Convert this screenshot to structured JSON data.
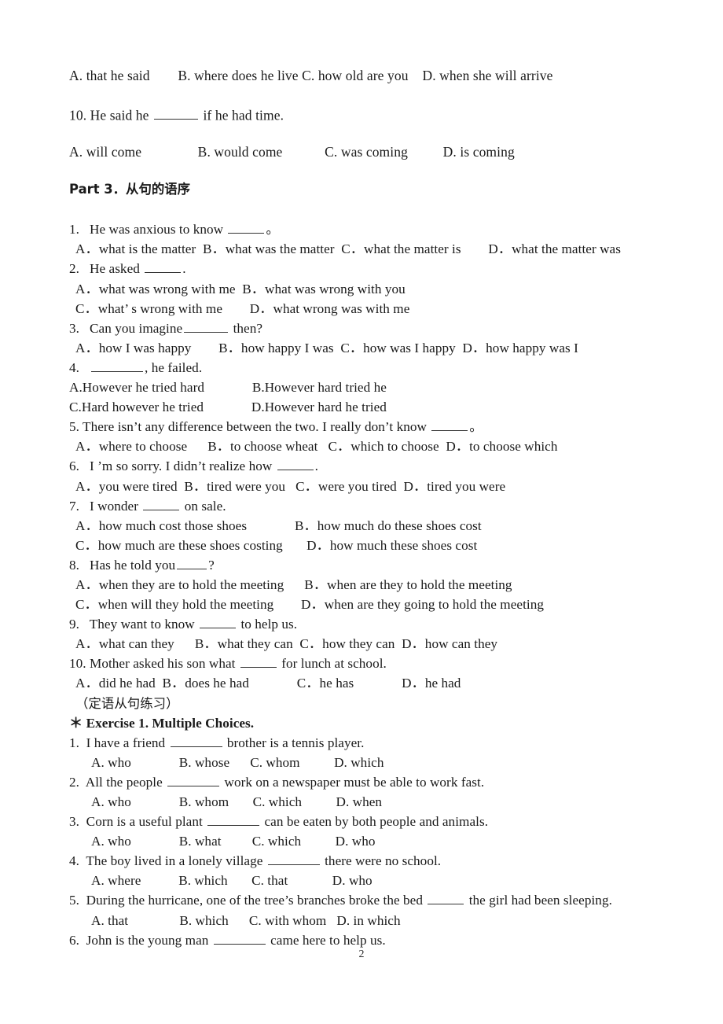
{
  "document": {
    "page_number": "2",
    "top_block": {
      "line_a": "A. that he said        B. where does he live C. how old are you    D. when she will arrive",
      "q10_stem_before": "10. He said he ",
      "q10_stem_after": " if he had time.",
      "q10_options": "A. will come                B. would come            C. was coming          D. is coming"
    },
    "part3": {
      "heading": "Part 3．从句的语序",
      "questions": [
        {
          "stem_before": "1.   He was anxious to know ",
          "stem_after": "。",
          "option_lines": [
            "A．what is the matter  B．what was the matter  C．what the matter is        D．what the matter was"
          ]
        },
        {
          "stem_before": "2.   He asked ",
          "stem_after": ".",
          "option_lines": [
            "A．what was wrong with me  B．what was wrong with you",
            "C．what’ s wrong with me        D．what wrong was with me"
          ]
        },
        {
          "stem_before": "3.   Can you imagine",
          "stem_after": " then?",
          "option_lines": [
            "A．how I was happy        B．how happy I was  C．how was I happy  D．how happy was I"
          ]
        },
        {
          "stem_before": "4.   ",
          "stem_after": ", he failed.",
          "option_lines": [
            "A.However he tried hard              B.However hard tried he",
            "C.Hard however he tried              D.However hard he tried"
          ]
        },
        {
          "stem_before": "5. There isn’t any difference between the two. I really don’t know ",
          "stem_after": "。",
          "option_lines": [
            "A．where to choose      B．to choose wheat   C．which to choose  D．to choose which"
          ]
        },
        {
          "stem_before": "6.   I ’m so sorry. I didn’t realize how ",
          "stem_after": ".",
          "option_lines": [
            "A．you were tired  B．tired were you   C．were you tired  D．tired you were"
          ]
        },
        {
          "stem_before": "7.   I wonder ",
          "stem_after": " on sale.",
          "option_lines": [
            "A．how much cost those shoes              B．how much do these shoes cost",
            "C．how much are these shoes costing       D．how much these shoes cost"
          ]
        },
        {
          "stem_before": "8.   Has he told you",
          "stem_after": "?",
          "option_lines": [
            "A．when they are to hold the meeting      B．when are they to hold the meeting",
            "C．when will they hold the meeting        D．when are they going to hold the meeting"
          ]
        },
        {
          "stem_before": "9.   They want to know ",
          "stem_after": " to help us.",
          "option_lines": [
            "A．what can they      B．what they can  C．how they can  D．how can they"
          ]
        },
        {
          "stem_before": "10. Mother asked his son what ",
          "stem_after": " for lunch at school.",
          "option_lines": [
            "A．did he had  B．does he had              C．he has              D．he had"
          ]
        }
      ]
    },
    "attributive_section": {
      "chinese_heading": "（定语从句练习）",
      "exercise_heading": "＊ Exercise 1. Multiple Choices.",
      "questions": [
        {
          "stem_before": "1.  I have a friend ",
          "stem_after": " brother is a tennis player.",
          "option_line": "A. who              B. whose      C. whom          D. which"
        },
        {
          "stem_before": "2.  All the people ",
          "stem_after": " work on a newspaper must be able to work fast.",
          "option_line": "A. who              B. whom       C. which          D. when"
        },
        {
          "stem_before": "3.  Corn is a useful plant ",
          "stem_after": " can be eaten by both people and animals.",
          "option_line": "A. who              B. what         C. which          D. who"
        },
        {
          "stem_before": "4.  The boy lived in a lonely village ",
          "stem_after": " there were no school.",
          "option_line": "A. where           B. which       C. that             D. who"
        },
        {
          "stem_before": "5.  During the hurricane, one of the tree’s branches broke the bed ",
          "stem_after": " the girl had been sleeping.",
          "option_line": "A. that               B. which      C. with whom   D. in which"
        },
        {
          "stem_before": "6.  John is the young man ",
          "stem_after": " came here to help us.",
          "option_line": ""
        }
      ]
    }
  }
}
